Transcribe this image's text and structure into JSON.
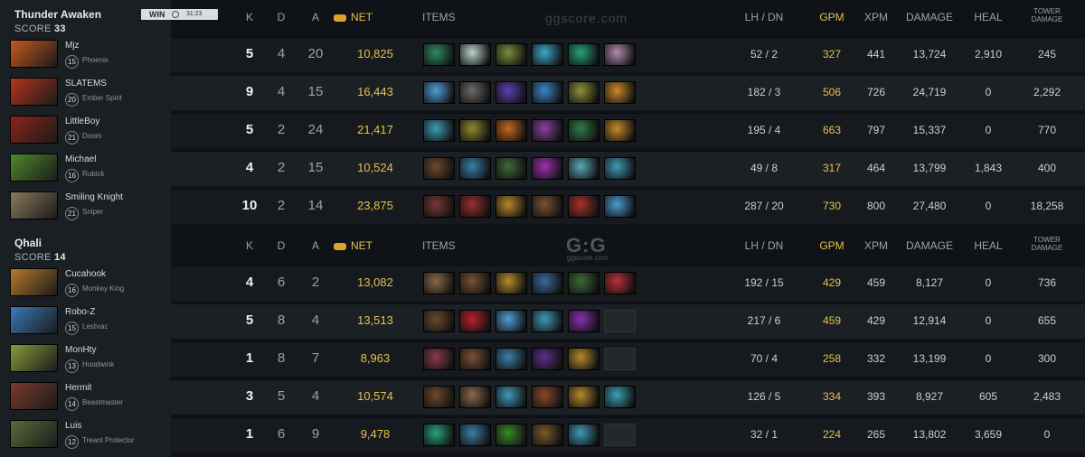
{
  "match": {
    "result": "WIN",
    "duration": "31:23"
  },
  "columns": {
    "k": "K",
    "d": "D",
    "a": "A",
    "net": "NET",
    "items": "ITEMS",
    "lh_dn": "LH / DN",
    "gpm": "GPM",
    "xpm": "XPM",
    "damage": "DAMAGE",
    "heal": "HEAL",
    "tower_damage": "TOWER\nDAMAGE"
  },
  "watermark": {
    "top": "ggscore.com",
    "logo": "G:G",
    "sub": "ggscore.com"
  },
  "teams": [
    {
      "name": "Thunder Awaken",
      "score_label": "SCORE",
      "score": "33",
      "players": [
        {
          "name": "Mjz",
          "level": "15",
          "hero": "Phoenix",
          "hero_color": "#c9591c",
          "k": "5",
          "d": "4",
          "a": "20",
          "net": "10,825",
          "lh_dn": "52 / 2",
          "gpm": "327",
          "xpm": "441",
          "damage": "13,724",
          "heal": "2,910",
          "tower": "245",
          "items": [
            "#2f8a63",
            "#b9d3c8",
            "#7a8e3a",
            "#3ea7c7",
            "#26a37a",
            "#b18bb0"
          ]
        },
        {
          "name": "SLATEMS",
          "level": "20",
          "hero": "Ember Spirit",
          "hero_color": "#b5341c",
          "k": "9",
          "d": "4",
          "a": "15",
          "net": "16,443",
          "lh_dn": "182 / 3",
          "gpm": "506",
          "xpm": "726",
          "damage": "24,719",
          "heal": "0",
          "tower": "2,292",
          "items": [
            "#4f9fd6",
            "#6d6a67",
            "#5a3fb0",
            "#3a86c9",
            "#8f8f3a",
            "#c98a2a"
          ]
        },
        {
          "name": "LittleBoy",
          "level": "21",
          "hero": "Doom",
          "hero_color": "#8e2318",
          "k": "5",
          "d": "2",
          "a": "24",
          "net": "21,417",
          "lh_dn": "195 / 4",
          "gpm": "663",
          "xpm": "797",
          "damage": "15,337",
          "heal": "0",
          "tower": "770",
          "items": [
            "#3f9ab6",
            "#8e8a2d",
            "#c4681f",
            "#8a3f9f",
            "#2f7a4a",
            "#c98a2a"
          ]
        },
        {
          "name": "Michael",
          "level": "16",
          "hero": "Rubick",
          "hero_color": "#4f8a2a",
          "k": "4",
          "d": "2",
          "a": "15",
          "net": "10,524",
          "lh_dn": "49 / 8",
          "gpm": "317",
          "xpm": "464",
          "damage": "13,799",
          "heal": "1,843",
          "tower": "400",
          "items": [
            "#6b4a2c",
            "#3a7ea8",
            "#3d6a3a",
            "#a02fae",
            "#5aa8b8",
            "#3f9ab6"
          ]
        },
        {
          "name": "Smiling Knight",
          "level": "21",
          "hero": "Sniper",
          "hero_color": "#8b7a5a",
          "k": "10",
          "d": "2",
          "a": "14",
          "net": "23,875",
          "lh_dn": "287 / 20",
          "gpm": "730",
          "xpm": "800",
          "damage": "27,480",
          "heal": "0",
          "tower": "18,258",
          "items": [
            "#7a3636",
            "#9b2e2e",
            "#b48a2a",
            "#7a5234",
            "#a8332a",
            "#4d9bd2"
          ]
        }
      ]
    },
    {
      "name": "Qhali",
      "score_label": "SCORE",
      "score": "14",
      "players": [
        {
          "name": "Cucahook",
          "level": "16",
          "hero": "Monkey King",
          "hero_color": "#b77a2a",
          "k": "4",
          "d": "6",
          "a": "2",
          "net": "13,082",
          "lh_dn": "192 / 15",
          "gpm": "429",
          "xpm": "459",
          "damage": "8,127",
          "heal": "0",
          "tower": "736",
          "items": [
            "#8a6a4a",
            "#7a5234",
            "#b48a2a",
            "#3a6a9a",
            "#3d6a3a",
            "#b8323a"
          ]
        },
        {
          "name": "Robo-Z",
          "level": "15",
          "hero": "Leshrac",
          "hero_color": "#3a7ab8",
          "k": "5",
          "d": "8",
          "a": "4",
          "net": "13,513",
          "lh_dn": "217 / 6",
          "gpm": "459",
          "xpm": "429",
          "damage": "12,914",
          "heal": "0",
          "tower": "655",
          "items": [
            "#6b4a2c",
            "#b8222a",
            "#4f9fd6",
            "#3f9ab6",
            "#8a2fb0",
            ""
          ]
        },
        {
          "name": "MonHty",
          "level": "13",
          "hero": "Hoodwink",
          "hero_color": "#8a9a3a",
          "k": "1",
          "d": "8",
          "a": "7",
          "net": "8,963",
          "lh_dn": "70 / 4",
          "gpm": "258",
          "xpm": "332",
          "damage": "13,199",
          "heal": "0",
          "tower": "300",
          "items": [
            "#8a3a4a",
            "#7a5234",
            "#3a7ea8",
            "#5a2f8a",
            "#b48a2a",
            ""
          ]
        },
        {
          "name": "Hermit",
          "level": "14",
          "hero": "Beastmaster",
          "hero_color": "#7a3a2a",
          "k": "3",
          "d": "5",
          "a": "4",
          "net": "10,574",
          "lh_dn": "126 / 5",
          "gpm": "334",
          "xpm": "393",
          "damage": "8,927",
          "heal": "605",
          "tower": "2,483",
          "items": [
            "#6b4a2c",
            "#8a6a4a",
            "#3f9ab6",
            "#8a4a2a",
            "#b48a2a",
            "#3aa0b8"
          ]
        },
        {
          "name": "Luis",
          "level": "12",
          "hero": "Treant Protector",
          "hero_color": "#5a6a3a",
          "k": "1",
          "d": "6",
          "a": "9",
          "net": "9,478",
          "lh_dn": "32 / 1",
          "gpm": "224",
          "xpm": "265",
          "damage": "13,802",
          "heal": "3,659",
          "tower": "0",
          "items": [
            "#26a37a",
            "#3a7ea8",
            "#3a8a2a",
            "#7a5a2a",
            "#3f9ab6",
            ""
          ]
        }
      ]
    }
  ]
}
